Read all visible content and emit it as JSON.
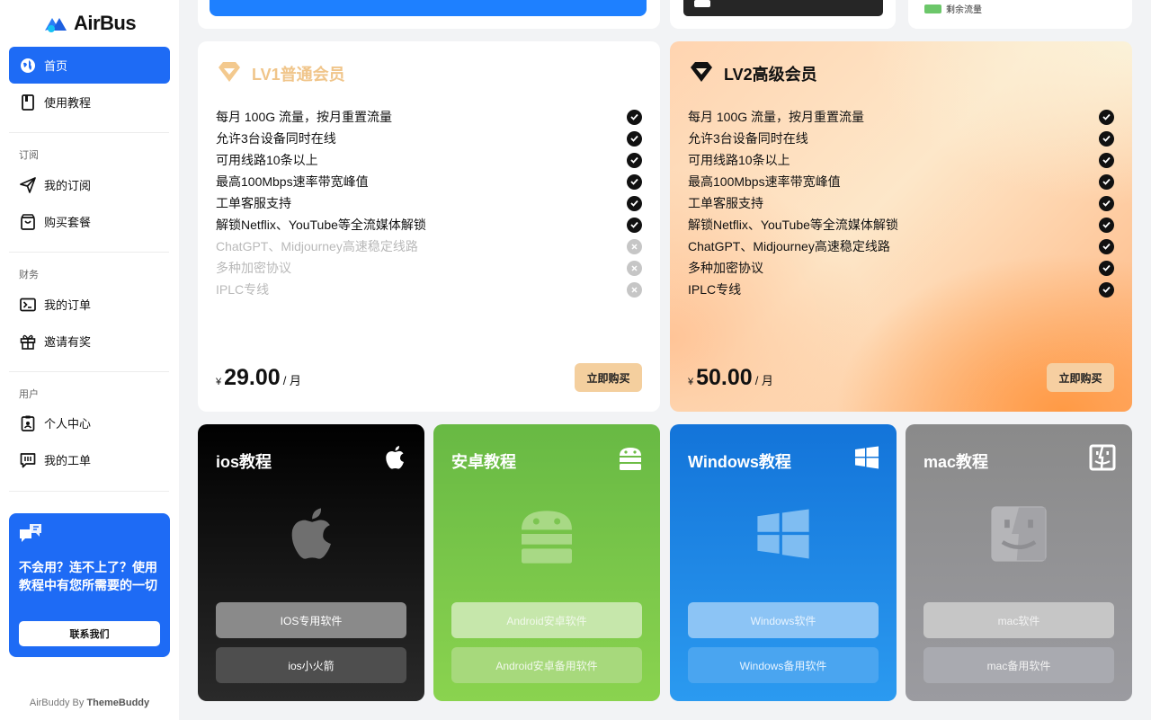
{
  "brand": {
    "name": "AirBus"
  },
  "sidebar": {
    "items": [
      {
        "label": "首页",
        "icon": "globe-icon"
      },
      {
        "label": "使用教程",
        "icon": "book-icon"
      },
      {
        "label": "我的订阅",
        "icon": "send-icon"
      },
      {
        "label": "购买套餐",
        "icon": "shopping-bag-icon"
      },
      {
        "label": "我的订单",
        "icon": "receipt-icon"
      },
      {
        "label": "邀请有奖",
        "icon": "gift-icon"
      },
      {
        "label": "个人中心",
        "icon": "id-badge-icon"
      },
      {
        "label": "我的工单",
        "icon": "ticket-icon"
      }
    ],
    "sections": {
      "subscribe": "订阅",
      "finance": "财务",
      "user": "用户"
    },
    "help": {
      "text": "不会用？连不上了？使用教程中有您所需要的一切",
      "button": "联系我们"
    },
    "credit_prefix": "AirBuddy By ",
    "credit_brand": "ThemeBuddy"
  },
  "top": {
    "legend_label": "剩余流量"
  },
  "plans": [
    {
      "title": "LV1普通会员",
      "features": [
        {
          "text": "每月 100G 流量，按月重置流量",
          "included": true
        },
        {
          "text": "允许3台设备同时在线",
          "included": true
        },
        {
          "text": "可用线路10条以上",
          "included": true
        },
        {
          "text": "最高100Mbps速率带宽峰值",
          "included": true
        },
        {
          "text": "工单客服支持",
          "included": true
        },
        {
          "text": "解锁Netflix、YouTube等全流媒体解锁",
          "included": true
        },
        {
          "text": "ChatGPT、Midjourney高速稳定线路",
          "included": false
        },
        {
          "text": "多种加密协议",
          "included": false
        },
        {
          "text": "IPLC专线",
          "included": false
        }
      ],
      "currency": "¥",
      "price": "29.00",
      "period": "/ 月",
      "buy": "立即购买"
    },
    {
      "title": "LV2高级会员",
      "features": [
        {
          "text": "每月 100G 流量，按月重置流量",
          "included": true
        },
        {
          "text": "允许3台设备同时在线",
          "included": true
        },
        {
          "text": "可用线路10条以上",
          "included": true
        },
        {
          "text": "最高100Mbps速率带宽峰值",
          "included": true
        },
        {
          "text": "工单客服支持",
          "included": true
        },
        {
          "text": "解锁Netflix、YouTube等全流媒体解锁",
          "included": true
        },
        {
          "text": "ChatGPT、Midjourney高速稳定线路",
          "included": true
        },
        {
          "text": "多种加密协议",
          "included": true
        },
        {
          "text": "IPLC专线",
          "included": true
        }
      ],
      "currency": "¥",
      "price": "50.00",
      "period": "/ 月",
      "buy": "立即购买"
    }
  ],
  "tutorials": [
    {
      "title": "ios教程",
      "icon": "apple-icon",
      "btn1": "IOS专用软件",
      "btn2": "ios小火箭"
    },
    {
      "title": "安卓教程",
      "icon": "android-icon",
      "btn1": "Android安卓软件",
      "btn2": "Android安卓备用软件"
    },
    {
      "title": "Windows教程",
      "icon": "windows-icon",
      "btn1": "Windows软件",
      "btn2": "Windows备用软件"
    },
    {
      "title": "mac教程",
      "icon": "finder-icon",
      "btn1": "mac软件",
      "btn2": "mac备用软件"
    }
  ]
}
